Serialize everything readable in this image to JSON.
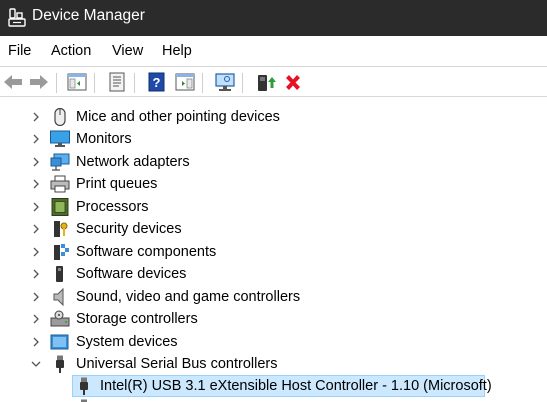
{
  "window": {
    "title": "Device Manager"
  },
  "menu": [
    "File",
    "Action",
    "View",
    "Help"
  ],
  "toolbar": {
    "icons": [
      "back-arrow-icon",
      "forward-arrow-icon",
      "show-hide-console-tree-icon",
      "properties-icon",
      "help-icon",
      "action-pane-icon",
      "scan-hardware-icon",
      "update-driver-icon",
      "uninstall-device-icon"
    ]
  },
  "tree": {
    "categories": [
      {
        "label": "Mice and other pointing devices",
        "icon": "mouse-icon",
        "expanded": false
      },
      {
        "label": "Monitors",
        "icon": "monitor-icon",
        "expanded": false
      },
      {
        "label": "Network adapters",
        "icon": "network-adapter-icon",
        "expanded": false
      },
      {
        "label": "Print queues",
        "icon": "printer-icon",
        "expanded": false
      },
      {
        "label": "Processors",
        "icon": "processor-icon",
        "expanded": false
      },
      {
        "label": "Security devices",
        "icon": "security-device-icon",
        "expanded": false
      },
      {
        "label": "Software components",
        "icon": "software-component-icon",
        "expanded": false
      },
      {
        "label": "Software devices",
        "icon": "software-device-icon",
        "expanded": false
      },
      {
        "label": "Sound, video and game controllers",
        "icon": "speaker-icon",
        "expanded": false
      },
      {
        "label": "Storage controllers",
        "icon": "storage-controller-icon",
        "expanded": false
      },
      {
        "label": "System devices",
        "icon": "system-device-icon",
        "expanded": false
      },
      {
        "label": "Universal Serial Bus controllers",
        "icon": "usb-icon",
        "expanded": true
      }
    ],
    "usb_children": [
      {
        "label": "Intel(R) USB 3.1 eXtensible Host Controller - 1.10 (Microsoft)",
        "icon": "usb-connector-icon",
        "selected": true
      }
    ]
  },
  "colors": {
    "titlebar_bg": "#2b2b2b",
    "selection_bg": "#cce8ff",
    "selection_border": "#99d1ff",
    "uninstall_red": "#e81123",
    "help_blue": "#1f4aa8"
  }
}
